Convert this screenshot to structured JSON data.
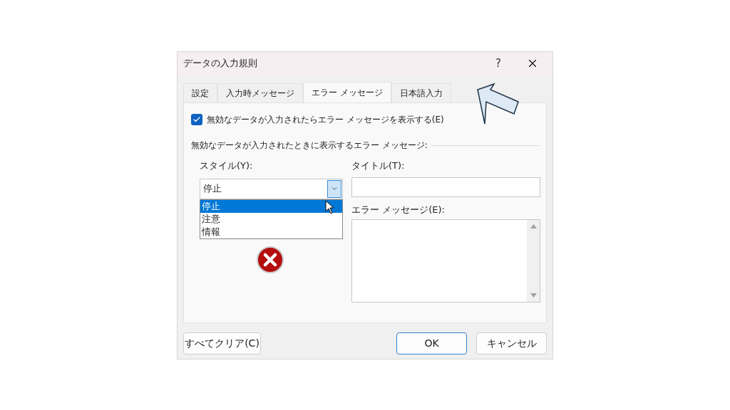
{
  "window": {
    "title": "データの入力規則",
    "help": "?"
  },
  "tabs": [
    {
      "label": "設定",
      "selected": false
    },
    {
      "label": "入力時メッセージ",
      "selected": false
    },
    {
      "label": "エラー メッセージ",
      "selected": true
    },
    {
      "label": "日本語入力",
      "selected": false
    }
  ],
  "show_error": {
    "label": "無効なデータが入力されたらエラー メッセージを表示する(E)",
    "checked": true
  },
  "group_label": "無効なデータが入力されたときに表示するエラー メッセージ:",
  "style": {
    "label": "スタイル(Y):",
    "value": "停止",
    "expanded": true,
    "options": [
      {
        "label": "停止",
        "selected": true
      },
      {
        "label": "注意",
        "selected": false
      },
      {
        "label": "情報",
        "selected": false
      }
    ]
  },
  "title_field": {
    "label": "タイトル(T):"
  },
  "message_field": {
    "label": "エラー メッセージ(E):"
  },
  "buttons": [
    {
      "label": "すべてクリア(C)",
      "default": false
    },
    {
      "label": "OK",
      "default": true
    },
    {
      "label": "キャンセル",
      "default": false
    }
  ]
}
